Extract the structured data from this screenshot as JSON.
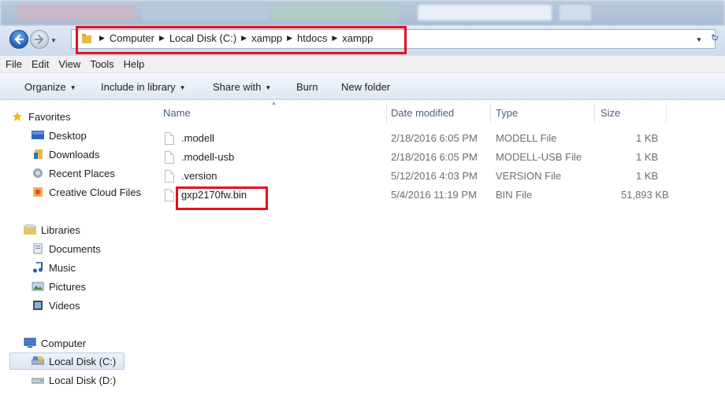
{
  "address_bar": {
    "crumbs": [
      "Computer",
      "Local Disk (C:)",
      "xampp",
      "htdocs",
      "xampp"
    ]
  },
  "menu": [
    "File",
    "Edit",
    "View",
    "Tools",
    "Help"
  ],
  "toolbar": {
    "organize": "Organize",
    "include_in_library": "Include in library",
    "share_with": "Share with",
    "burn": "Burn",
    "new_folder": "New folder"
  },
  "nav": {
    "favorites": {
      "label": "Favorites",
      "items": [
        "Desktop",
        "Downloads",
        "Recent Places",
        "Creative Cloud Files"
      ]
    },
    "libraries": {
      "label": "Libraries",
      "items": [
        "Documents",
        "Music",
        "Pictures",
        "Videos"
      ]
    },
    "computer": {
      "label": "Computer",
      "items": [
        "Local Disk (C:)",
        "Local Disk (D:)"
      ],
      "selected": "Local Disk (C:)"
    }
  },
  "columns": [
    "Name",
    "Date modified",
    "Type",
    "Size"
  ],
  "files": [
    {
      "name": ".modell",
      "date": "2/18/2016 6:05 PM",
      "type": "MODELL File",
      "size": "1 KB"
    },
    {
      "name": ".modell-usb",
      "date": "2/18/2016 6:05 PM",
      "type": "MODELL-USB File",
      "size": "1 KB"
    },
    {
      "name": ".version",
      "date": "5/12/2016 4:03 PM",
      "type": "VERSION File",
      "size": "1 KB"
    },
    {
      "name": "gxp2170fw.bin",
      "date": "5/4/2016 11:19 PM",
      "type": "BIN File",
      "size": "51,893 KB"
    }
  ],
  "highlight_color": "#e8101b"
}
